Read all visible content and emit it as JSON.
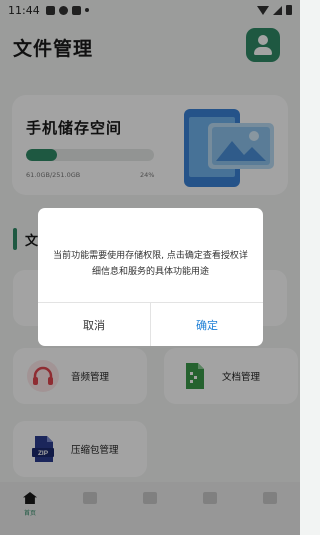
{
  "status_bar": {
    "time": "11:44"
  },
  "header": {
    "title": "文件管理"
  },
  "storage": {
    "title": "手机储存空间",
    "used_text": "61.0GB/251.0GB",
    "percent_text": "24%",
    "progress_fraction": 0.24
  },
  "section": {
    "title": "文"
  },
  "categories": [
    {
      "label": ""
    },
    {
      "label": ""
    },
    {
      "label": "音频管理",
      "icon": "headphones-icon",
      "color": "#e0454f"
    },
    {
      "label": "文档管理",
      "icon": "document-icon",
      "color": "#3a9a4a"
    },
    {
      "label": "压缩包管理",
      "icon": "zip-icon",
      "color": "#2b3c8f"
    }
  ],
  "dialog": {
    "message": "当前功能需要使用存储权限, 点击确定查看授权详细信息和服务的具体功能用途",
    "cancel_label": "取消",
    "confirm_label": "确定"
  },
  "bottom_nav": [
    {
      "label": "首页",
      "active": true
    },
    {
      "label": "",
      "active": false
    },
    {
      "label": "",
      "active": false
    },
    {
      "label": "",
      "active": false
    },
    {
      "label": "",
      "active": false
    }
  ],
  "colors": {
    "accent": "#2f8a66",
    "confirm": "#1d7fd6"
  }
}
